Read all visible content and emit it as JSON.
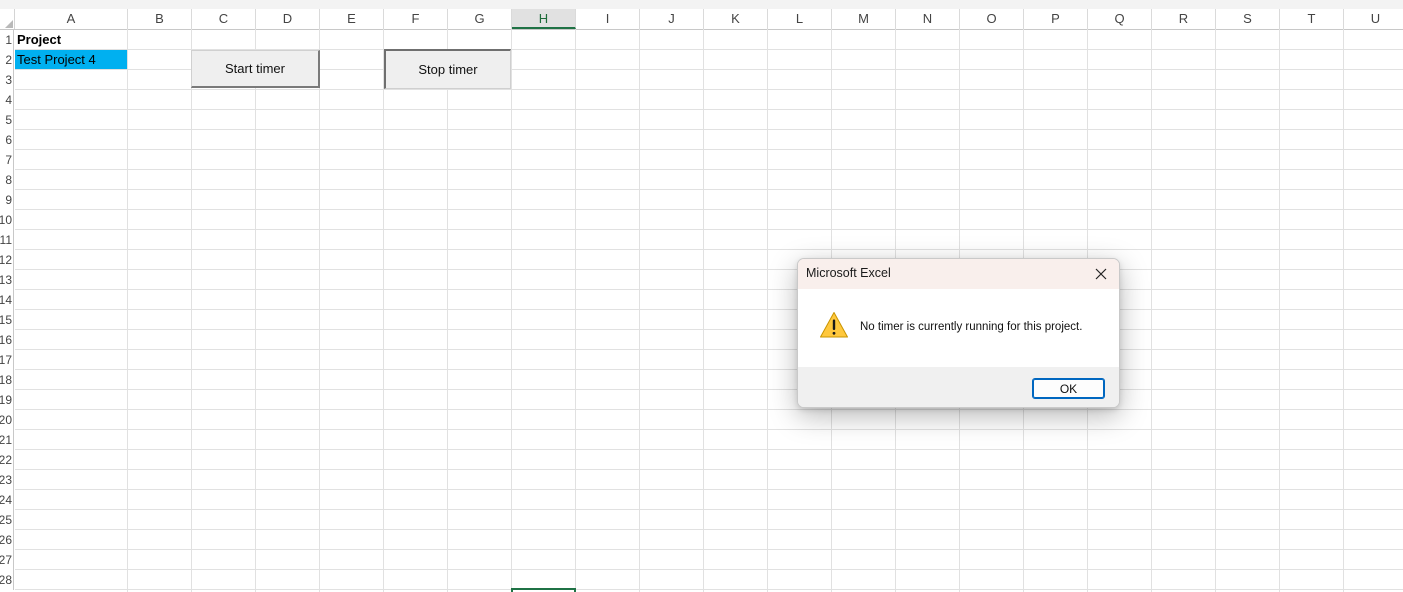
{
  "sheet": {
    "columns": [
      "A",
      "B",
      "C",
      "D",
      "E",
      "F",
      "G",
      "H",
      "I",
      "J",
      "K",
      "L",
      "M",
      "N",
      "O",
      "P",
      "Q",
      "R",
      "S",
      "T",
      "U"
    ],
    "selected_column": "H",
    "rows": [
      "1",
      "2",
      "3",
      "4",
      "5",
      "6",
      "7",
      "8",
      "9",
      "10",
      "11",
      "12",
      "13",
      "14",
      "15",
      "16",
      "17",
      "18",
      "19",
      "20",
      "21",
      "22",
      "23",
      "24",
      "25",
      "26",
      "27",
      "28"
    ],
    "cells": {
      "A1": "Project",
      "A2": "Test Project 4"
    },
    "highlight_color": "#00b0f0",
    "selection_color": "#1f7245"
  },
  "buttons": {
    "start_label": "Start timer",
    "stop_label": "Stop timer"
  },
  "dialog": {
    "title": "Microsoft Excel",
    "message": "No timer is currently running for this project.",
    "ok_label": "OK",
    "icon": "warning-icon",
    "close_icon": "close-icon"
  }
}
